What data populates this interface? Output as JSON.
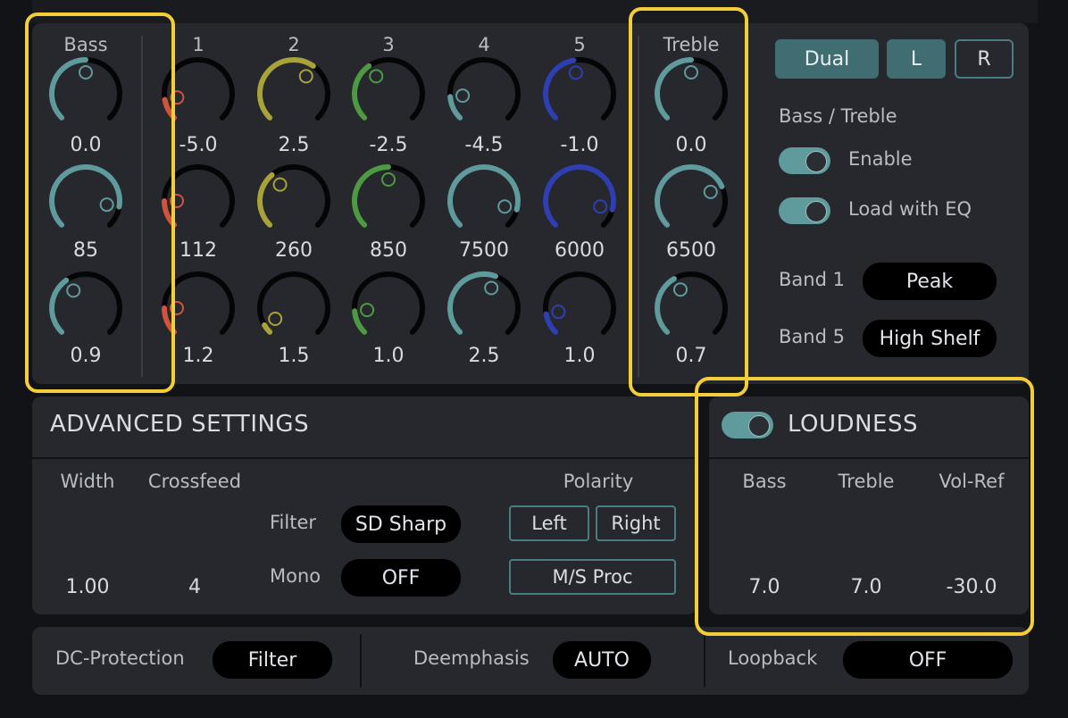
{
  "eq": {
    "bass": {
      "label": "Bass",
      "values": [
        "0.0",
        "85",
        "0.9"
      ]
    },
    "bands": [
      {
        "label": "1",
        "gain": "-5.0",
        "freq": "112",
        "q": "1.2",
        "color": "#d0533e"
      },
      {
        "label": "2",
        "gain": "2.5",
        "freq": "260",
        "q": "1.5",
        "color": "#a8a23a"
      },
      {
        "label": "3",
        "gain": "-2.5",
        "freq": "850",
        "q": "1.0",
        "color": "#4e9a43"
      },
      {
        "label": "4",
        "gain": "-4.5",
        "freq": "7500",
        "q": "2.5",
        "color": "#5f9a9d"
      },
      {
        "label": "5",
        "gain": "-1.0",
        "freq": "6000",
        "q": "1.0",
        "color": "#2f3fb1"
      }
    ],
    "treble": {
      "label": "Treble",
      "values": [
        "0.0",
        "6500",
        "0.7"
      ]
    }
  },
  "channel": {
    "dual": "Dual",
    "left": "L",
    "right": "R"
  },
  "bass_treble": {
    "title": "Bass / Treble",
    "enable": "Enable",
    "load_with_eq": "Load with EQ",
    "band1_label": "Band 1",
    "band1_value": "Peak",
    "band5_label": "Band 5",
    "band5_value": "High Shelf"
  },
  "advanced": {
    "title": "ADVANCED SETTINGS",
    "width_label": "Width",
    "width_value": "1.00",
    "crossfeed_label": "Crossfeed",
    "crossfeed_value": "4",
    "filter_label": "Filter",
    "filter_value": "SD Sharp",
    "mono_label": "Mono",
    "mono_value": "OFF",
    "polarity_label": "Polarity",
    "polarity_left": "Left",
    "polarity_right": "Right",
    "ms_proc": "M/S Proc"
  },
  "loudness": {
    "title": "LOUDNESS",
    "bass_label": "Bass",
    "bass_value": "7.0",
    "treble_label": "Treble",
    "treble_value": "7.0",
    "volref_label": "Vol-Ref",
    "volref_value": "-30.0"
  },
  "bottom": {
    "dc_label": "DC-Protection",
    "dc_value": "Filter",
    "deemph_label": "Deemphasis",
    "deemph_value": "AUTO",
    "loopback_label": "Loopback",
    "loopback_value": "OFF"
  },
  "colors": {
    "teal": "#5f9a9d",
    "highlight": "#f3cd3a"
  }
}
